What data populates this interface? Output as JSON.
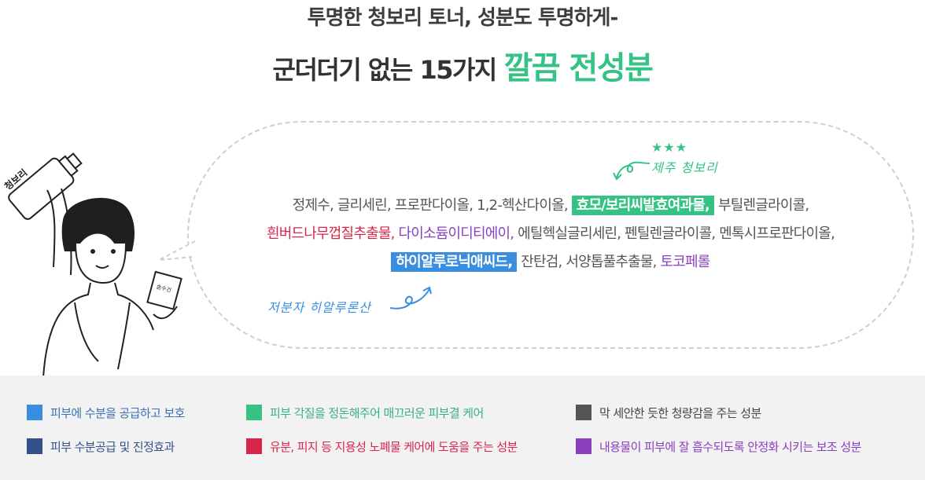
{
  "headline": {
    "line1": "투명한 청보리 토너, 성분도 투명하게-",
    "line2_prefix": "군더더기 없는 15가지 ",
    "line2_accent": "깔끔 전성분"
  },
  "illustration": {
    "bottle_label": "청보리",
    "card_label": "솜수건"
  },
  "annotations": {
    "stars": "★★★",
    "jeju": "제주 청보리",
    "hyaluronic": "저분자 히알루론산"
  },
  "ingredients": {
    "line1": [
      {
        "text": "정제수, 글리세린, 프로판다이올, 1,2-헥산다이올, ",
        "style": "gray"
      },
      {
        "text": "효모/보리씨발효여과물,",
        "style": "hl-green"
      },
      {
        "text": " 부틸렌글라이콜,",
        "style": "gray"
      }
    ],
    "line2": [
      {
        "text": "흰버드나무껍질추출물, ",
        "style": "red"
      },
      {
        "text": "다이소듐이디티에이, ",
        "style": "purple"
      },
      {
        "text": "에틸헥실글리세린, 펜틸렌글라이콜, 멘톡시프로판다이올,",
        "style": "gray"
      }
    ],
    "line3": [
      {
        "text": "하이알루로닉애씨드,",
        "style": "hl-blue"
      },
      {
        "text": " 잔탄검, 서양톱풀추출물, ",
        "style": "gray"
      },
      {
        "text": "토코페롤",
        "style": "purple"
      }
    ]
  },
  "legend": [
    {
      "label": "피부에 수분을 공급하고 보호",
      "color": "#3a8ee0",
      "text_color": "#3a6fb5"
    },
    {
      "label": "피부 각질을 정돈해주어 매끄러운 피부결 케어",
      "color": "#35c285",
      "text_color": "#35b27c"
    },
    {
      "label": "막 세안한 듯한 청량감을 주는 성분",
      "color": "#555555",
      "text_color": "#444444"
    },
    {
      "label": "피부 수분공급 및 진정효과",
      "color": "#34508a",
      "text_color": "#34508a"
    },
    {
      "label": "유분, 피지 등 지용성 노폐물 케어에 도움을 주는 성분",
      "color": "#d8264a",
      "text_color": "#d8264a"
    },
    {
      "label": "내용물이 피부에 잘 흡수되도록 안정화 시키는 보조 성분",
      "color": "#8a3fbf",
      "text_color": "#8a3fbf"
    }
  ]
}
